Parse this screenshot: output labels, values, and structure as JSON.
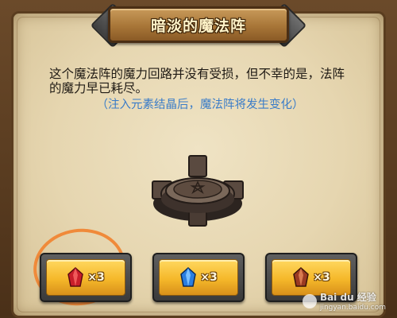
{
  "dialog": {
    "title": "暗淡的魔法阵",
    "description": "这个魔法阵的魔力回路并没有受损，但不幸的是，法阵的魔力早已耗尽。",
    "hint": "（注入元素结晶后，魔法阵将发生变化）"
  },
  "buttons": [
    {
      "gem": "red-crystal-icon",
      "color": "#b01a22",
      "count_label": "×3"
    },
    {
      "gem": "blue-crystal-icon",
      "color": "#2a7ee0",
      "count_label": "×3"
    },
    {
      "gem": "brown-crystal-icon",
      "color": "#9a3a22",
      "count_label": "×3"
    }
  ],
  "colors": {
    "title_text": "#fff3c8",
    "hint_text": "#3a7cc8",
    "button_gold": "#f5b82a",
    "highlight_ring": "#f08a3a"
  },
  "watermark": {
    "brand": "Bai du 经验",
    "url": "jingyan.baidu.com"
  }
}
